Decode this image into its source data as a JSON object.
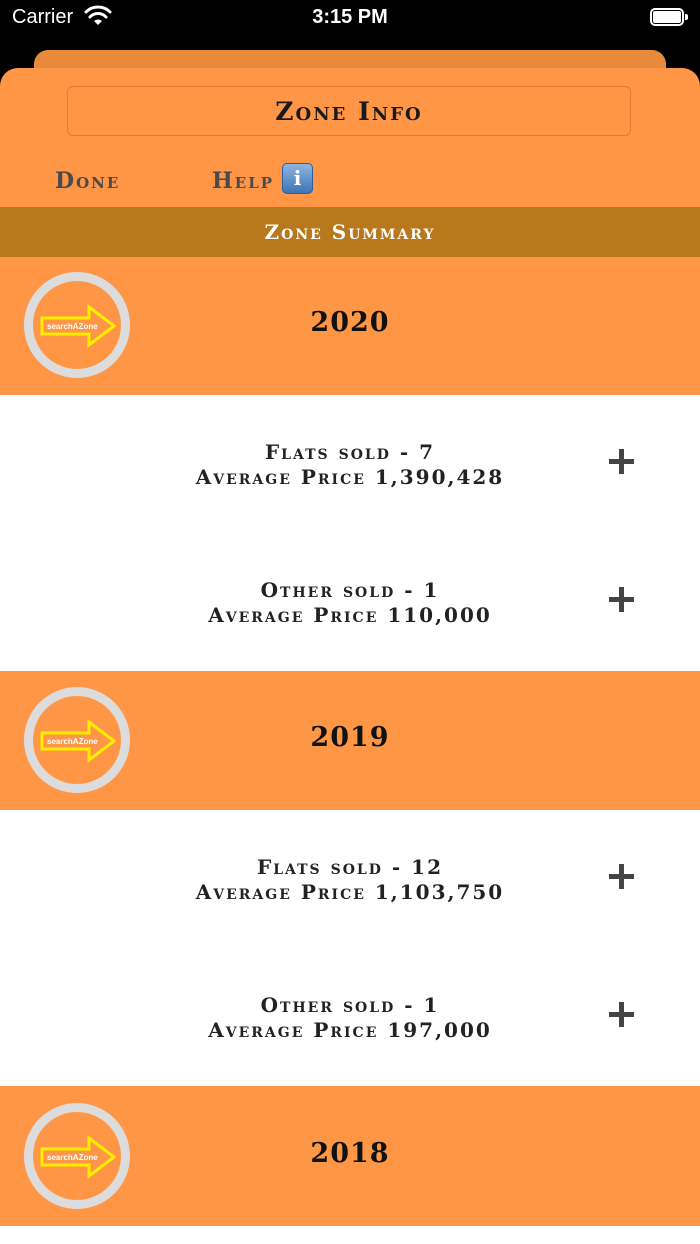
{
  "status_bar": {
    "carrier": "Carrier",
    "time": "3:15 PM"
  },
  "header": {
    "title": "Zone Info",
    "done_label": "Done",
    "help_label": "Help",
    "info_icon": "i"
  },
  "summary_title": "Zone Summary",
  "logo_text": "searchAZone",
  "colors": {
    "accent": "#ff9646",
    "summary_bar": "#b8781c",
    "logo_arrow": "#ffee00"
  },
  "sections": [
    {
      "year": "2020",
      "items": [
        {
          "line1": "Flats sold - 7",
          "line2": "Average Price 1,390,428"
        },
        {
          "line1": "Other sold - 1",
          "line2": "Average Price 110,000"
        }
      ]
    },
    {
      "year": "2019",
      "items": [
        {
          "line1": "Flats sold - 12",
          "line2": "Average Price 1,103,750"
        },
        {
          "line1": "Other sold - 1",
          "line2": "Average Price 197,000"
        }
      ]
    },
    {
      "year": "2018",
      "items": []
    }
  ]
}
